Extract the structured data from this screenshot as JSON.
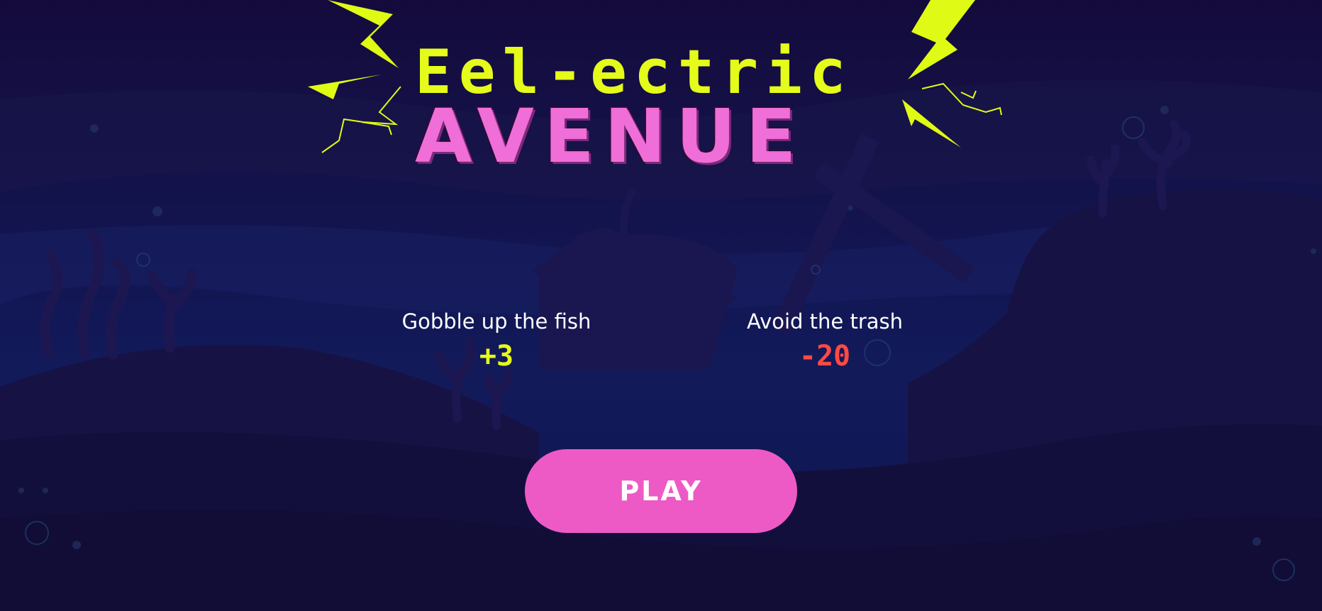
{
  "game": {
    "title_line1": "Eel-ectric",
    "title_line2": "AVENUE"
  },
  "rules": {
    "fish_label": "Gobble up the fish",
    "fish_points": "+3",
    "trash_label": "Avoid the trash",
    "trash_points": "-20"
  },
  "play_button": {
    "label": "PLAY"
  },
  "colors": {
    "background_deep": "#140d3a",
    "title_yellow": "#e5fb1a",
    "title_pink": "#ef6ed8",
    "play_button": "#ee5ac5",
    "penalty_red": "#ff4a44"
  },
  "icons": [
    "lightning-bolt-icon",
    "seaweed-icon",
    "shipwreck-silhouette",
    "bubble-icon"
  ]
}
